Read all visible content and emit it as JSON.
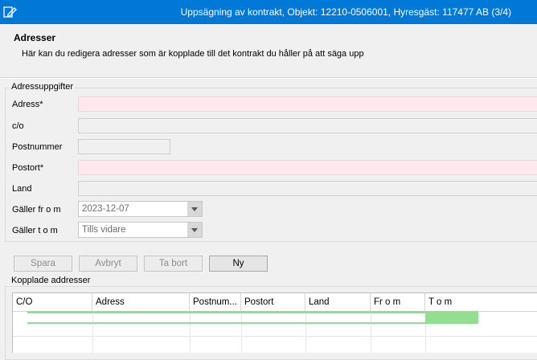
{
  "window": {
    "title": "Uppsägning av kontrakt, Objekt: 12210-0506001, Hyresgäst: 117477 AB (3/4)"
  },
  "header": {
    "title": "Adresser",
    "description": "Här kan du redigera adresser som är kopplade till det kontrakt du håller på att säga upp"
  },
  "address_group": {
    "title": "Adressuppgifter",
    "fields": {
      "adress_label": "Adress*",
      "adress_value": "",
      "co_label": "c/o",
      "co_value": "",
      "postnummer_label": "Postnummer",
      "postnummer_value": "",
      "postort_label": "Postort*",
      "postort_value": "",
      "land_label": "Land",
      "land_value": "",
      "galler_from_label": "Gäller fr o m",
      "galler_from_value": "2023-12-07",
      "galler_tom_label": "Gäller t o m",
      "galler_tom_value": "Tills vidare"
    }
  },
  "buttons": {
    "spara": "Spara",
    "avbryt": "Avbryt",
    "ta_bort": "Ta bort",
    "ny": "Ny"
  },
  "linked_group": {
    "title": "Kopplade addresser",
    "columns": [
      "C/O",
      "Adress",
      "Postnum...",
      "Postort",
      "Land",
      "Fr o m",
      "T o m"
    ]
  },
  "colors": {
    "titlebar": "#0078d7",
    "required_field": "#ffe8ee",
    "row_highlight": "#90e090"
  }
}
